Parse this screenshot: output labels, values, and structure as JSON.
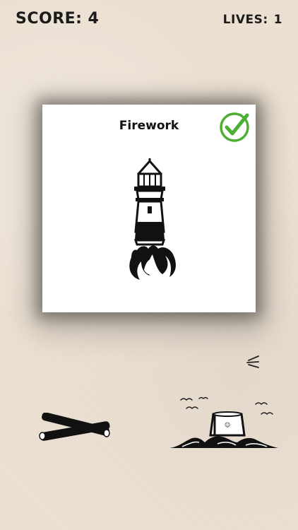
{
  "hud": {
    "score_label": "SCORE:",
    "score_value": "4",
    "lives_label": "LIVES:",
    "lives_value": "1"
  },
  "card": {
    "word": "Firework",
    "icon": "lighthouse-with-flame-icon",
    "status_icon": "check-icon",
    "status_color": "#4caf32"
  },
  "scene": {
    "items": [
      {
        "name": "swoosh-icon"
      },
      {
        "name": "crossed-logs-icon"
      },
      {
        "name": "bucket-in-waves-with-birds-icon"
      }
    ]
  }
}
